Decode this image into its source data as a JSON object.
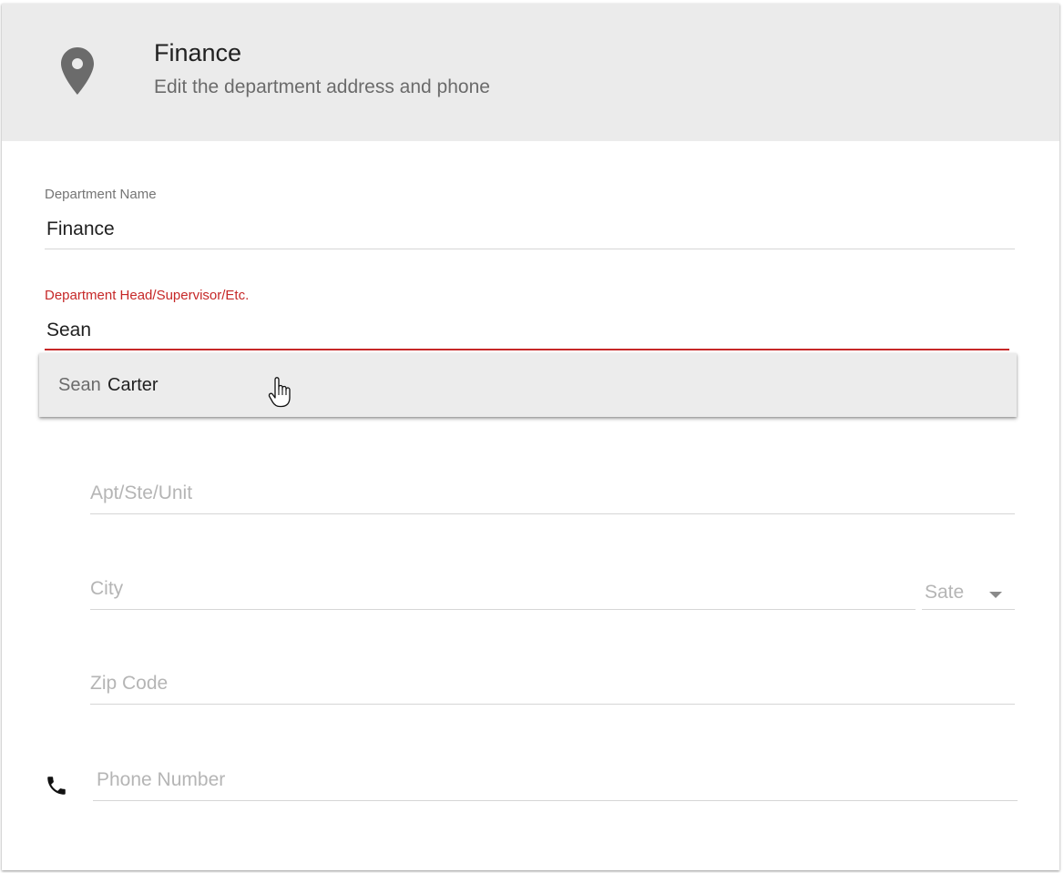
{
  "header": {
    "icon": "map-marker-icon",
    "title": "Finance",
    "subtitle": "Edit the department address and phone"
  },
  "colors": {
    "header_bg": "#ebebeb",
    "accent_error": "#c62828",
    "icon_gray": "#6b6b6b"
  },
  "form": {
    "department_name": {
      "label": "Department Name",
      "value": "Finance"
    },
    "department_head": {
      "label": "Department Head/Supervisor/Etc.",
      "value": "Sean"
    },
    "autocomplete": {
      "options": [
        {
          "match": "Sean",
          "rest": "Carter"
        }
      ]
    },
    "apt": {
      "placeholder": "Apt/Ste/Unit"
    },
    "city": {
      "placeholder": "City"
    },
    "state": {
      "selected": "Sate"
    },
    "zip": {
      "placeholder": "Zip Code"
    },
    "phone": {
      "placeholder": "Phone Number",
      "icon": "phone-icon"
    }
  }
}
